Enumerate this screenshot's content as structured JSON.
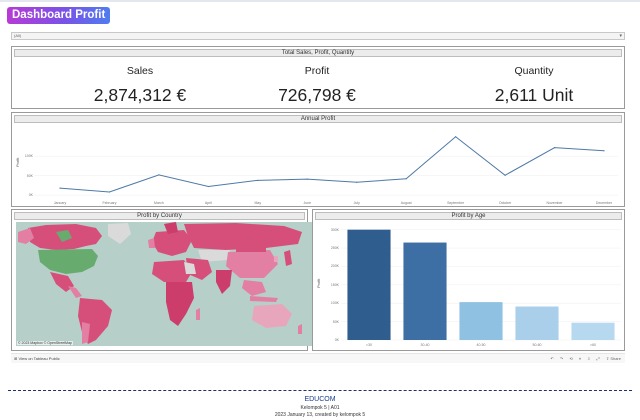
{
  "title": "Dashboard Profit",
  "filter": {
    "value": "(All)"
  },
  "kpi_panel": {
    "header": "Total Sales, Profit, Quantity",
    "items": [
      {
        "label": "Sales",
        "value": "2,874,312 €"
      },
      {
        "label": "Profit",
        "value": "726,798 €"
      },
      {
        "label": "Quantity",
        "value": "2,611 Unit"
      }
    ]
  },
  "annual_panel": {
    "header": "Annual Profit"
  },
  "country_panel": {
    "header": "Profit by Country",
    "attribution": "© 2023 Mapbox © OpenStreetMap"
  },
  "age_panel": {
    "header": "Profit by Age"
  },
  "chart_data": [
    {
      "type": "line",
      "title": "Annual Profit",
      "ylabel": "Profit",
      "x": [
        "January",
        "February",
        "March",
        "April",
        "May",
        "June",
        "July",
        "August",
        "September",
        "October",
        "November",
        "December"
      ],
      "yticks": [
        "0K",
        "50K",
        "100K"
      ],
      "ylim": [
        -10000,
        175000
      ],
      "series": [
        {
          "values": [
            18000,
            8000,
            52000,
            22000,
            38000,
            41000,
            33000,
            42000,
            150000,
            51000,
            122000,
            114000
          ]
        }
      ],
      "line_color": "#4e79a7"
    },
    {
      "type": "bar",
      "title": "Profit by Age",
      "ylabel": "Profit",
      "categories": [
        "<30",
        "30-40",
        "40-50",
        "50-60",
        ">60"
      ],
      "yticks": [
        "0K",
        "50K",
        "100K",
        "150K",
        "200K",
        "250K",
        "300K"
      ],
      "ylim": [
        0,
        310000
      ],
      "values": [
        300000,
        265000,
        103000,
        91000,
        47000
      ],
      "colors": [
        "#2f5d8e",
        "#3d6fa5",
        "#8fc1e3",
        "#a9cfea",
        "#b7d9f0"
      ]
    }
  ],
  "toolbar": {
    "view_on": "View on Tableau Public",
    "share": "Share"
  },
  "footer": {
    "line1": "EDUCOM",
    "line2": "Kelompok 5 | A01",
    "line3": "2023 January 13, created by kelompok 5"
  }
}
